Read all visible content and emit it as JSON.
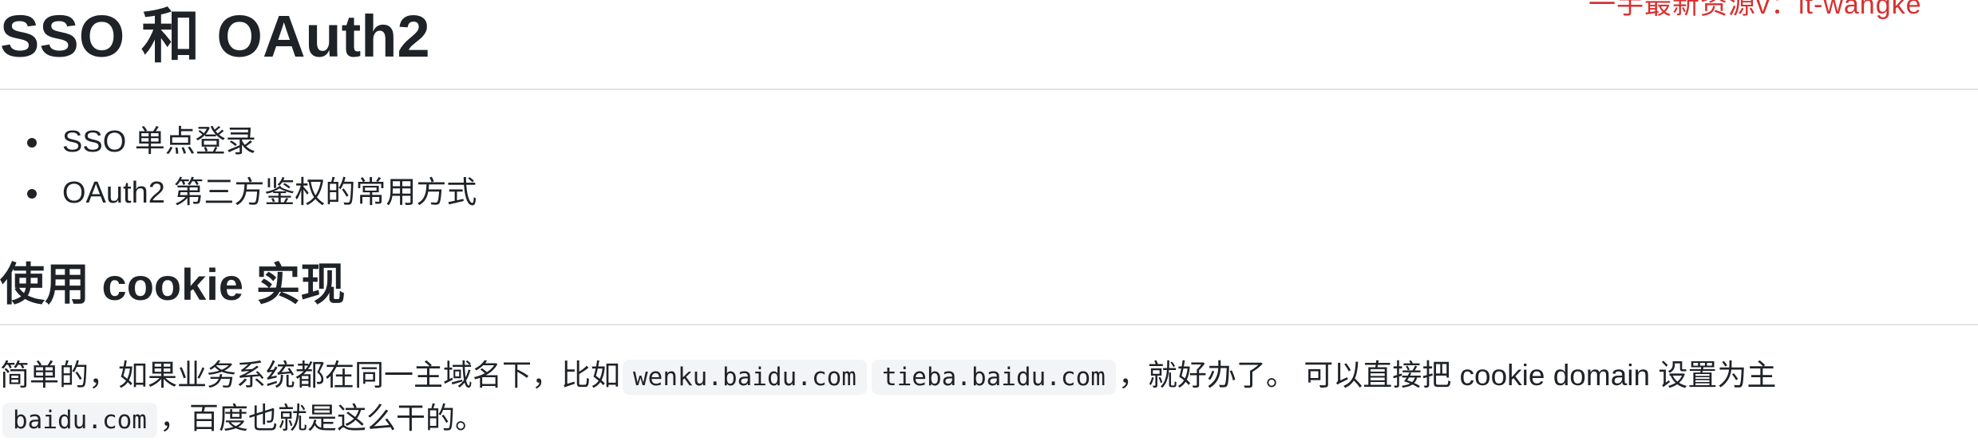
{
  "watermark": "一手最新资源v：it-wangke",
  "title": "SSO 和 OAuth2",
  "bullets": [
    "SSO 单点登录",
    "OAuth2 第三方鉴权的常用方式"
  ],
  "section_heading": "使用 cookie 实现",
  "paragraph": {
    "text1": "简单的，如果业务系统都在同一主域名下，比如",
    "code1": "wenku.baidu.com",
    "code2": "tieba.baidu.com",
    "text2": "，就好办了。 可以直接把 cookie domain 设置为主",
    "code3": "baidu.com",
    "text3": "，百度也就是这么干的。"
  }
}
